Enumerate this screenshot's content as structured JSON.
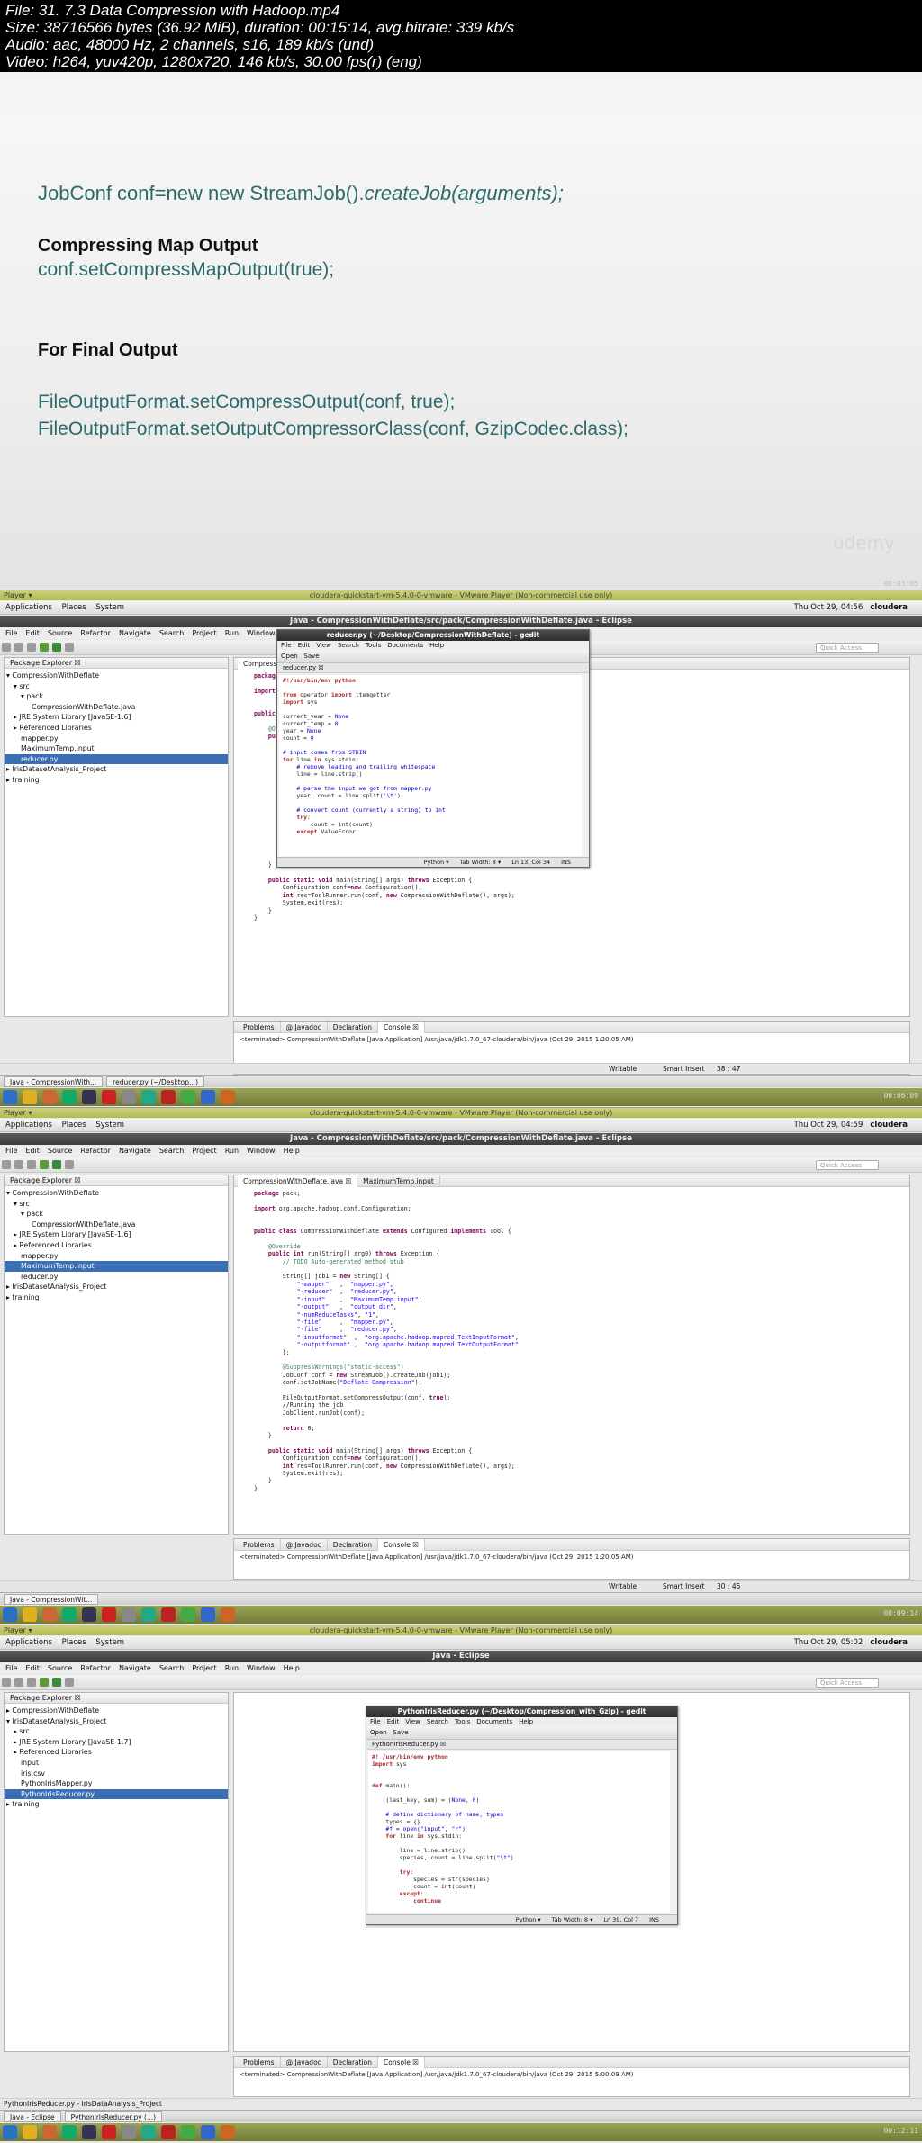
{
  "info": {
    "line1": "File: 31. 7.3 Data Compression with Hadoop.mp4",
    "line2": "Size: 38716566 bytes (36.92 MiB), duration: 00:15:14, avg.bitrate: 339 kb/s",
    "line3": "Audio: aac, 48000 Hz, 2 channels, s16, 189 kb/s (und)",
    "line4": "Video: h264, yuv420p, 1280x720, 146 kb/s, 30.00 fps(r) (eng)"
  },
  "slide": {
    "line1_plain": "JobConf conf=new new StreamJob().",
    "line1_italic": "createJob(arguments);",
    "heading1": "Compressing Map Output",
    "code1": "conf.setCompressMapOutput(true);",
    "heading2": "For Final Output",
    "code2": "FileOutputFormat.setCompressOutput(conf, true);",
    "code3": "FileOutputFormat.setOutputCompressorClass(conf, GzipCodec.class);",
    "watermark": "udemy",
    "timestamp": "00:03:05"
  },
  "common": {
    "vm_title": "cloudera-quickstart-vm-5.4.0-0-vmware - VMware Player (Non-commercial use only)",
    "player_label": "Player ▾",
    "panel_items": [
      "Applications",
      "Places",
      "System"
    ],
    "user": "cloudera",
    "menu_items": [
      "File",
      "Edit",
      "Source",
      "Refactor",
      "Navigate",
      "Search",
      "Project",
      "Run",
      "Window",
      "Help"
    ],
    "quick_access": "Quick Access",
    "package_explorer": "Package Explorer ☒",
    "console_tabs": [
      "Problems",
      "@ Javadoc",
      "Declaration",
      "Console ☒"
    ],
    "writable": "Writable",
    "smart_insert": "Smart Insert",
    "gedit_menu": [
      "File",
      "Edit",
      "View",
      "Search",
      "Tools",
      "Documents",
      "Help"
    ],
    "gedit_open": "Open",
    "gedit_save": "Save",
    "gedit_lang": "Python ▾",
    "gedit_tab": "Tab Width: 8 ▾",
    "gedit_ins": "INS"
  },
  "frame1": {
    "clock": "Thu Oct 29, 04:56",
    "eclipse_title": "Java - CompressionWithDeflate/src/pack/CompressionWithDeflate.java - Eclipse",
    "tree": [
      {
        "t": "▾ CompressionWithDeflate",
        "ind": 2,
        "sel": false
      },
      {
        "t": "▾ src",
        "ind": 10,
        "sel": false
      },
      {
        "t": "▾ pack",
        "ind": 18,
        "sel": false
      },
      {
        "t": "CompressionWithDeflate.java",
        "ind": 30,
        "sel": false
      },
      {
        "t": "▸ JRE System Library [JavaSE-1.6]",
        "ind": 10,
        "sel": false
      },
      {
        "t": "▸ Referenced Libraries",
        "ind": 10,
        "sel": false
      },
      {
        "t": "mapper.py",
        "ind": 18,
        "sel": false
      },
      {
        "t": "MaximumTemp.input",
        "ind": 18,
        "sel": false
      },
      {
        "t": "reducer.py",
        "ind": 18,
        "sel": true
      },
      {
        "t": "▸ IrisDatasetAnalysis_Project",
        "ind": 2,
        "sel": false
      },
      {
        "t": "▸ training",
        "ind": 2,
        "sel": false
      }
    ],
    "editor_tab": "CompressionWithDeflate.java",
    "gedit_title": "reducer.py (~/Desktop/CompressionWithDeflate) - gedit",
    "gedit_file": "reducer.py ☒",
    "gedit_pos": "Ln 13, Col 34",
    "console_line": "<terminated> CompressionWithDeflate [Java Application] /usr/java/jdk1.7.0_67-cloudera/bin/java (Oct 29, 2015 1:20:05 AM)",
    "position": "38 : 47",
    "tasks": [
      "Java - CompressionWith...",
      "reducer.py (~/Desktop...)"
    ],
    "timestamp": "00:06:09"
  },
  "frame2": {
    "clock": "Thu Oct 29, 04:59",
    "eclipse_title": "Java - CompressionWithDeflate/src/pack/CompressionWithDeflate.java - Eclipse",
    "tree": [
      {
        "t": "▾ CompressionWithDeflate",
        "ind": 2,
        "sel": false
      },
      {
        "t": "▾ src",
        "ind": 10,
        "sel": false
      },
      {
        "t": "▾ pack",
        "ind": 18,
        "sel": false
      },
      {
        "t": "CompressionWithDeflate.java",
        "ind": 30,
        "sel": false
      },
      {
        "t": "▸ JRE System Library [JavaSE-1.6]",
        "ind": 10,
        "sel": false
      },
      {
        "t": "▸ Referenced Libraries",
        "ind": 10,
        "sel": false
      },
      {
        "t": "mapper.py",
        "ind": 18,
        "sel": false
      },
      {
        "t": "MaximumTemp.input",
        "ind": 18,
        "sel": true
      },
      {
        "t": "reducer.py",
        "ind": 18,
        "sel": false
      },
      {
        "t": "▸ IrisDatasetAnalysis_Project",
        "ind": 2,
        "sel": false
      },
      {
        "t": "▸ training",
        "ind": 2,
        "sel": false
      }
    ],
    "editor_tabs": [
      "CompressionWithDeflate.java ☒",
      "MaximumTemp.input"
    ],
    "console_line": "<terminated> CompressionWithDeflate [Java Application] /usr/java/jdk1.7.0_67-cloudera/bin/java (Oct 29, 2015 1:20:05 AM)",
    "position": "30 : 45",
    "tasks": [
      "Java - CompressionWit..."
    ],
    "timestamp": "00:09:14"
  },
  "frame3": {
    "clock": "Thu Oct 29, 05:02",
    "eclipse_title": "Java - Eclipse",
    "tree": [
      {
        "t": "▸ CompressionWithDeflate",
        "ind": 2,
        "sel": false
      },
      {
        "t": "▾ IrisDatasetAnalysis_Project",
        "ind": 2,
        "sel": false
      },
      {
        "t": "▸ src",
        "ind": 10,
        "sel": false
      },
      {
        "t": "▸ JRE System Library [JavaSE-1.7]",
        "ind": 10,
        "sel": false
      },
      {
        "t": "▸ Referenced Libraries",
        "ind": 10,
        "sel": false
      },
      {
        "t": "input",
        "ind": 18,
        "sel": false
      },
      {
        "t": "iris.csv",
        "ind": 18,
        "sel": false
      },
      {
        "t": "PythonIrisMapper.py",
        "ind": 18,
        "sel": false
      },
      {
        "t": "PythonIrisReducer.py",
        "ind": 18,
        "sel": true
      },
      {
        "t": "▸ training",
        "ind": 2,
        "sel": false
      }
    ],
    "gedit_title": "PythonIrisReducer.py (~/Desktop/Compression_with_Gzip) - gedit",
    "gedit_file": "PythonIrisReducer.py ☒",
    "gedit_pos": "Ln 39, Col 7",
    "console_line": "<terminated> CompressionWithDeflate [Java Application] /usr/java/jdk1.7.0_67-cloudera/bin/java (Oct 29, 2015 5:00:09 AM)",
    "status_left": "PythonIrisReducer.py - IrisDataAnalysis_Project",
    "tasks": [
      "Java - Eclipse",
      "PythonIrisReducer.py (...)"
    ],
    "timestamp": "00:12:11"
  },
  "colors": {
    "accent_teal": "#2c6a6a",
    "selection": "#3a6fb5",
    "taskbar_olive": "#8c9548"
  }
}
